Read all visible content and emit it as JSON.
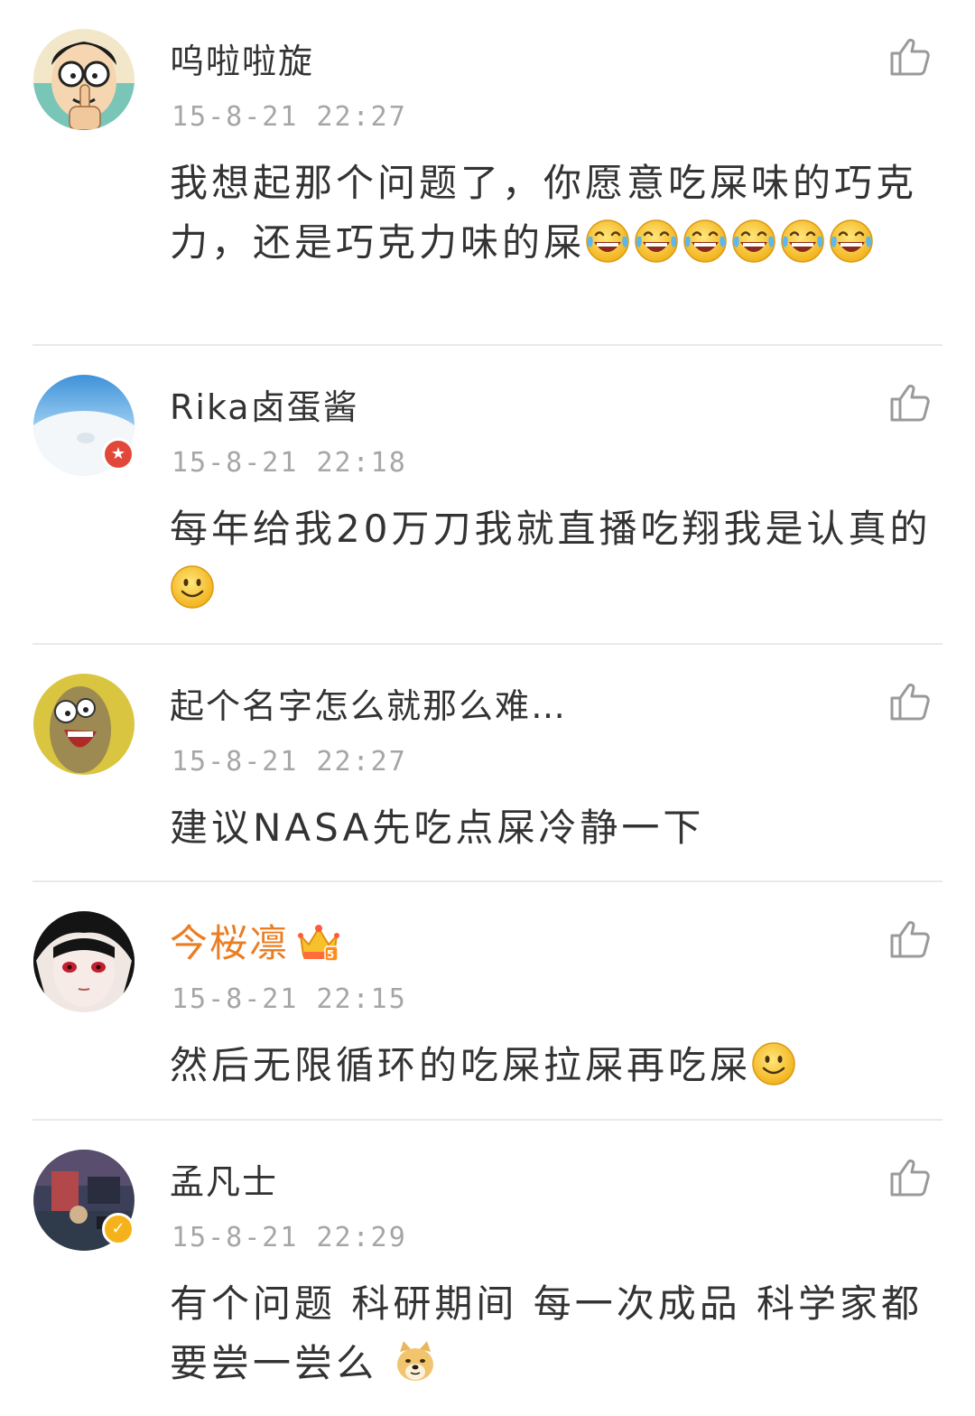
{
  "comments": [
    {
      "username": "呜啦啦旋",
      "time": "15-8-21 22:27",
      "text": "我想起那个问题了，你愿意吃屎味的巧克力，还是巧克力味的屎",
      "emoji_icons": [
        "laugh-cry-emoji",
        "laugh-cry-emoji",
        "laugh-cry-emoji",
        "laugh-cry-emoji",
        "laugh-cry-emoji",
        "laugh-cry-emoji"
      ]
    },
    {
      "username": "Rika卤蛋酱",
      "time": "15-8-21 22:18",
      "text": "每年给我20万刀我就直播吃翔我是认真的",
      "emoji_icons": [
        "smile-emoji"
      ],
      "badge_icon": "red-star-badge-icon"
    },
    {
      "username": "起个名字怎么就那么难…",
      "time": "15-8-21 22:27",
      "text": "建议NASA先吃点屎冷静一下"
    },
    {
      "username": "今桜凛",
      "time": "15-8-21 22:15",
      "text": "然后无限循环的吃屎拉屎再吃屎",
      "emoji_icons": [
        "smile-emoji"
      ],
      "member_icon": "crown-vip-icon",
      "username_color": "#eb7d22"
    },
    {
      "username": "孟凡士",
      "time": "15-8-21 22:29",
      "text": "有个问题 科研期间 每一次成品 科学家都要尝一尝么 ",
      "emoji_icons": [
        "doge-emoji"
      ],
      "badge_icon": "verified-v-badge-icon"
    }
  ],
  "like_icon": "thumbs-up-icon",
  "colors": {
    "username": "#333333",
    "timestamp": "#a6a6a6",
    "divider": "#e9e9e9",
    "vip_name": "#eb7d22"
  }
}
